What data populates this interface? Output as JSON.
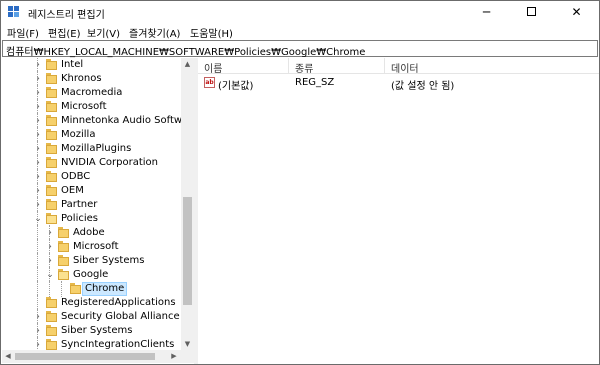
{
  "window": {
    "title": "레지스트리 편집기",
    "icon": "registry-editor-icon",
    "controls": {
      "minimize": "─",
      "close": "✕"
    }
  },
  "menu": [
    {
      "label": "파일(F)"
    },
    {
      "label": "편집(E)"
    },
    {
      "label": "보기(V)"
    },
    {
      "label": "즐겨찾기(A)"
    },
    {
      "label": "도움말(H)"
    }
  ],
  "address": "컴퓨터₩HKEY_LOCAL_MACHINE₩SOFTWARE₩Policies₩Google₩Chrome",
  "tree": {
    "items": [
      {
        "label": "Intel",
        "level": 0,
        "expander": "collapsed"
      },
      {
        "label": "Khronos",
        "level": 0,
        "expander": "collapsed"
      },
      {
        "label": "Macromedia",
        "level": 0,
        "expander": "collapsed"
      },
      {
        "label": "Microsoft",
        "level": 0,
        "expander": "collapsed"
      },
      {
        "label": "Minnetonka Audio Software",
        "level": 0,
        "expander": "collapsed"
      },
      {
        "label": "Mozilla",
        "level": 0,
        "expander": "collapsed"
      },
      {
        "label": "MozillaPlugins",
        "level": 0,
        "expander": "collapsed"
      },
      {
        "label": "NVIDIA Corporation",
        "level": 0,
        "expander": "collapsed"
      },
      {
        "label": "ODBC",
        "level": 0,
        "expander": "collapsed"
      },
      {
        "label": "OEM",
        "level": 0,
        "expander": "collapsed"
      },
      {
        "label": "Partner",
        "level": 0,
        "expander": "collapsed"
      },
      {
        "label": "Policies",
        "level": 0,
        "expander": "expanded"
      },
      {
        "label": "Adobe",
        "level": 1,
        "expander": "collapsed"
      },
      {
        "label": "Microsoft",
        "level": 1,
        "expander": "collapsed"
      },
      {
        "label": "Siber Systems",
        "level": 1,
        "expander": "collapsed"
      },
      {
        "label": "Google",
        "level": 1,
        "expander": "expanded"
      },
      {
        "label": "Chrome",
        "level": 2,
        "expander": "none",
        "selected": true
      },
      {
        "label": "RegisteredApplications",
        "level": 0,
        "expander": "none"
      },
      {
        "label": "Security Global Alliance",
        "level": 0,
        "expander": "collapsed"
      },
      {
        "label": "Siber Systems",
        "level": 0,
        "expander": "collapsed"
      },
      {
        "label": "SyncIntegrationClients",
        "level": 0,
        "expander": "collapsed"
      }
    ]
  },
  "list": {
    "columns": [
      "이름",
      "종류",
      "데이터"
    ],
    "rows": [
      {
        "name": "(기본값)",
        "type": "REG_SZ",
        "data": "(값 설정 안 됨)",
        "icon": "string-value-icon"
      }
    ]
  },
  "colors": {
    "selection_bg": "#cce8ff",
    "folder": "#f6d06b"
  }
}
